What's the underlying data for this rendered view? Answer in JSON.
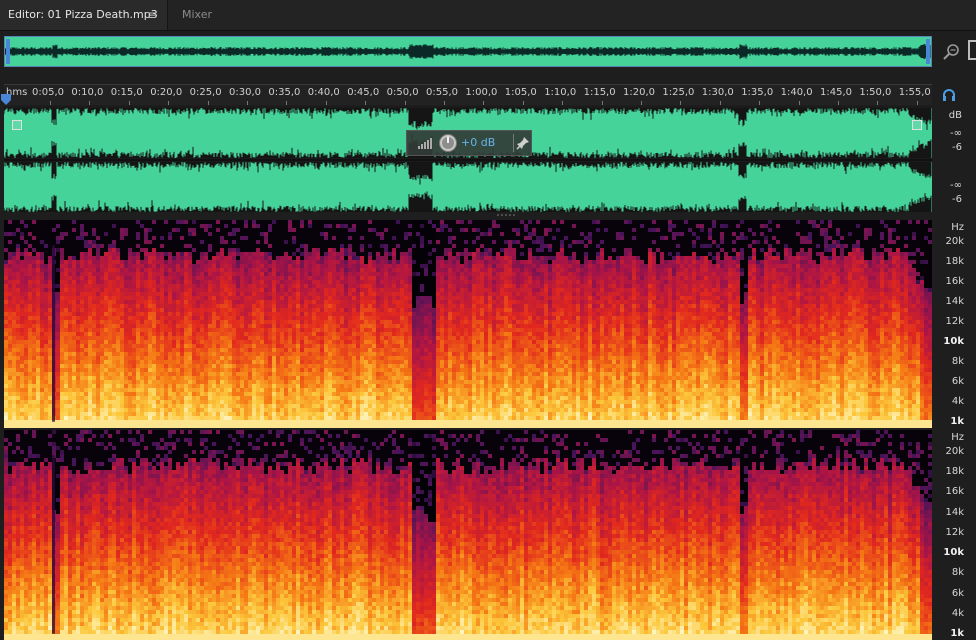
{
  "tabs": {
    "editor_label": "Editor: 01 Pizza Death.mp3",
    "menu_glyph": "≡",
    "mixer_label": "Mixer"
  },
  "ruler": {
    "unit_label": "hms",
    "ticks": [
      "0:05,0",
      "0:10,0",
      "0:15,0",
      "0:20,0",
      "0:25,0",
      "0:30,0",
      "0:35,0",
      "0:40,0",
      "0:45,0",
      "0:50,0",
      "0:55,0",
      "1:00,0",
      "1:05,0",
      "1:10,0",
      "1:15,0",
      "1:20,0",
      "1:25,0",
      "1:30,0",
      "1:35,0",
      "1:40,0",
      "1:45,0",
      "1:50,0",
      "1:55,0"
    ]
  },
  "hud": {
    "volume_label": "+0 dB"
  },
  "amplitude_scale": {
    "unit": "dB",
    "channel1": [
      "-∞",
      "-6"
    ],
    "channel2": [
      "-∞",
      "-6"
    ]
  },
  "spectral_scale": {
    "unit": "Hz",
    "labels": [
      "20k",
      "18k",
      "16k",
      "14k",
      "12k",
      "10k",
      "8k",
      "6k",
      "4k",
      "1k"
    ],
    "bold": [
      "10k",
      "1k"
    ]
  },
  "colors": {
    "waveform": "#45d39a",
    "waveform_dark": "#0d3b37",
    "accent": "#4a86d6",
    "hud_text": "#67b4e8"
  },
  "icons": {
    "zoom": "zoom-icon",
    "playhead": "playhead-marker-icon",
    "monitor": "headphones-icon",
    "pin": "pin-icon",
    "level": "level-meter-icon",
    "knob": "volume-knob-icon"
  }
}
